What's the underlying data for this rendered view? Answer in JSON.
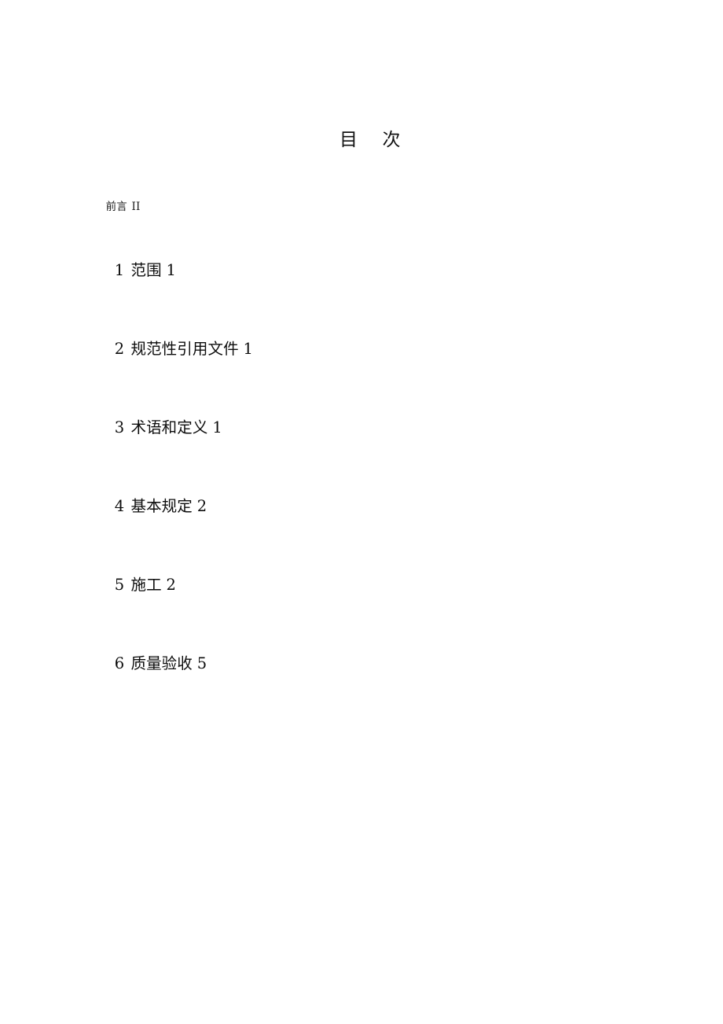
{
  "document": {
    "title": "目    次",
    "title_text": "目",
    "title_text_2": "次",
    "page_background": "#ffffff",
    "text_color": "#000000"
  },
  "toc": {
    "heading": "目    次",
    "front_matter": [
      {
        "label": "前言",
        "page": "II"
      }
    ],
    "entries": [
      {
        "number": "1",
        "label": "范围",
        "page": "1"
      },
      {
        "number": "2",
        "label": "规范性引用文件",
        "page": "1"
      },
      {
        "number": "3",
        "label": "术语和定义",
        "page": "1"
      },
      {
        "number": "4",
        "label": "基本规定",
        "page": "2"
      },
      {
        "number": "5",
        "label": "施工",
        "page": "2"
      },
      {
        "number": "6",
        "label": "质量验收",
        "page": "5"
      }
    ]
  }
}
